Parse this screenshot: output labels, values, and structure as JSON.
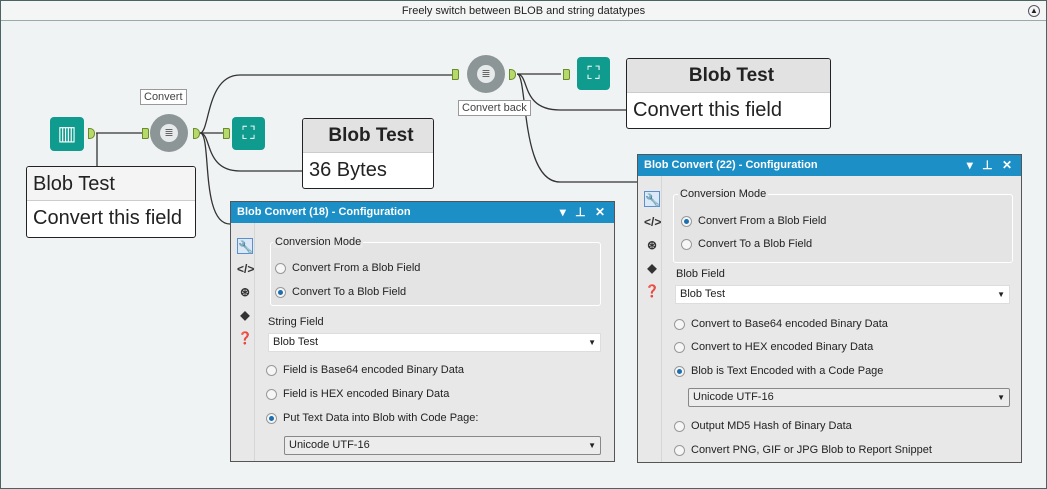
{
  "canvas": {
    "title": "Freely switch between BLOB and string datatypes",
    "collapse_icon": "collapse-up-icon"
  },
  "workflow": {
    "convert_label": "Convert",
    "convert_back_label": "Convert back",
    "input_table": {
      "header": "Blob Test",
      "value": "Convert this field"
    },
    "browse1_table": {
      "header": "Blob Test",
      "value": "36 Bytes"
    },
    "browse2_table": {
      "header": "Blob Test",
      "value": "Convert this field"
    }
  },
  "panel1": {
    "title": "Blob Convert (18) - Configuration",
    "controls": "▾ ⊥ ✕",
    "group_label": "Conversion Mode",
    "mode_options": [
      "Convert From a Blob Field",
      "Convert To a Blob Field"
    ],
    "mode_selected": 1,
    "field_label": "String Field",
    "field_value": "Blob Test",
    "options": [
      "Field is Base64 encoded Binary Data",
      "Field is HEX encoded Binary Data",
      "Put Text Data into Blob with Code Page:"
    ],
    "option_selected": 2,
    "code_page": "Unicode UTF-16"
  },
  "panel2": {
    "title": "Blob Convert (22) - Configuration",
    "controls": "▾ ⊥ ✕",
    "group_label": "Conversion Mode",
    "mode_options": [
      "Convert From a Blob Field",
      "Convert To a Blob Field"
    ],
    "mode_selected": 0,
    "field_label": "Blob Field",
    "field_value": "Blob Test",
    "options": [
      "Convert to Base64 encoded Binary Data",
      "Convert to HEX encoded Binary Data",
      "Blob is Text Encoded with a Code Page",
      "Output MD5 Hash of Binary Data",
      "Convert PNG, GIF or JPG Blob to Report Snippet"
    ],
    "option_selected": 2,
    "code_page": "Unicode UTF-16"
  },
  "colors": {
    "accent": "#1b8fc6",
    "tool_teal": "#0f9b8e",
    "anchor": "#b5d96a"
  }
}
